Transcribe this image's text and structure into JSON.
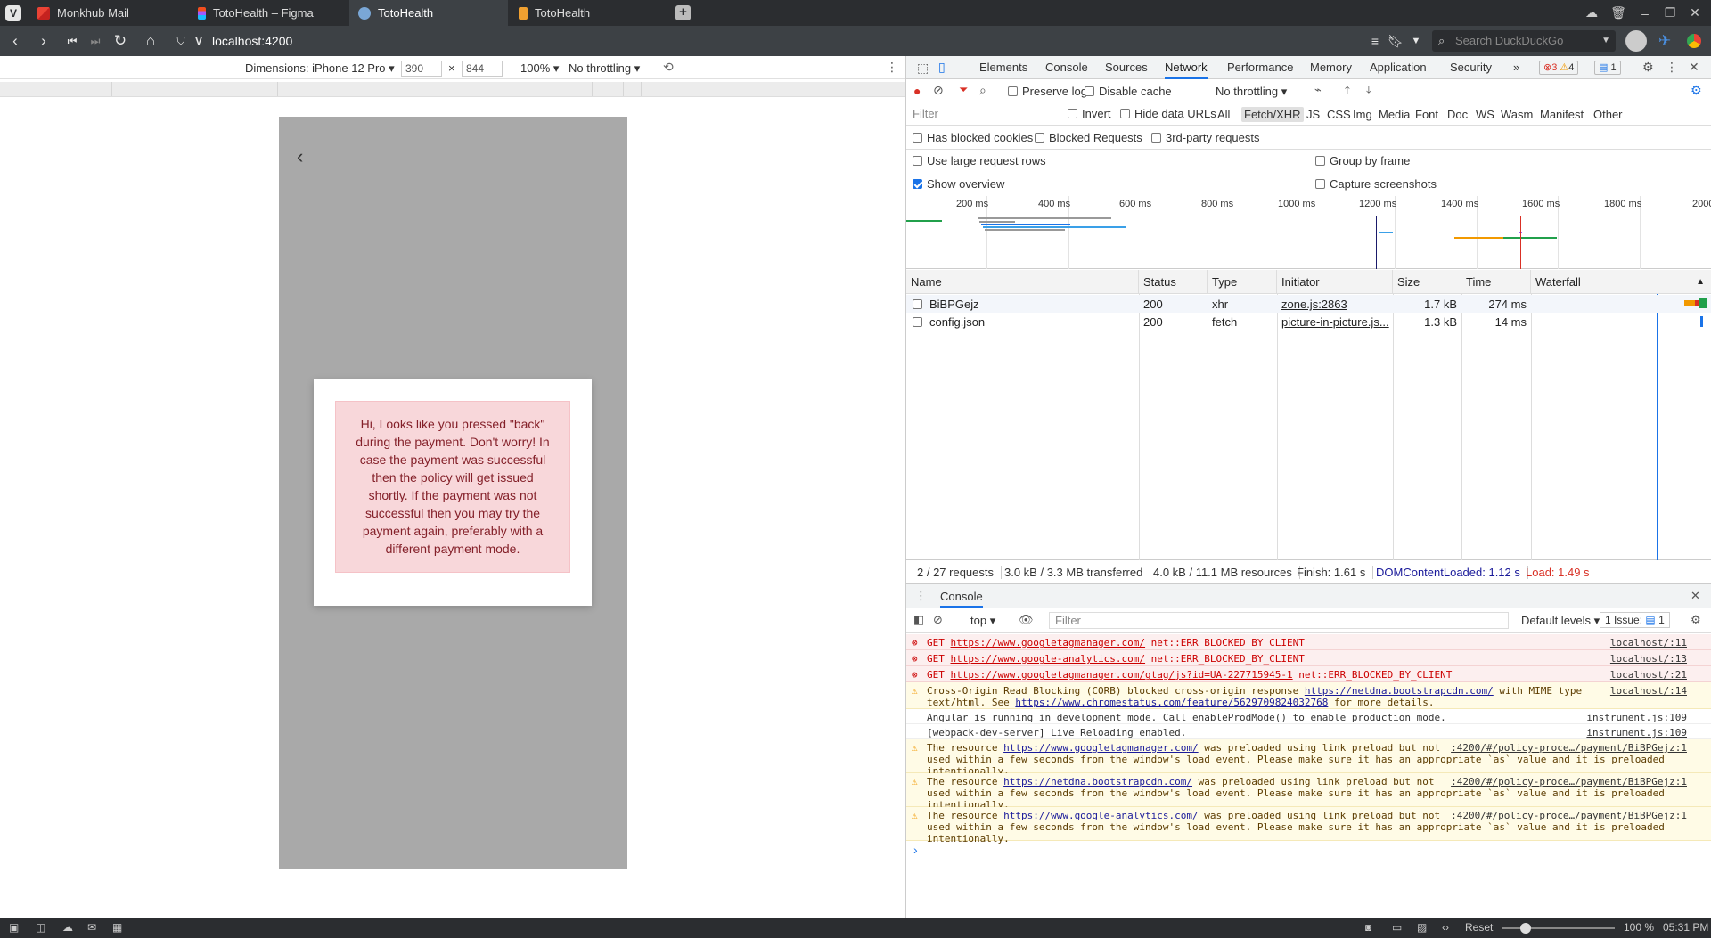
{
  "browser": {
    "tabs": [
      {
        "label": "Monkhub Mail",
        "favicon": "gmail-icon"
      },
      {
        "label": "TotoHealth – Figma",
        "favicon": "figma-icon"
      },
      {
        "label": "TotoHealth",
        "favicon": "totohealth-icon",
        "active": true
      },
      {
        "label": "TotoHealth",
        "favicon": "angular-icon"
      }
    ],
    "url": "localhost:4200",
    "search_placeholder": "Search DuckDuckGo"
  },
  "device_toolbar": {
    "dimensions_label": "Dimensions: iPhone 12 Pro",
    "width": "390",
    "height": "844",
    "times": "×",
    "zoom": "100%",
    "throttling": "No throttling"
  },
  "page": {
    "alert_text": "Hi, Looks like you pressed \"back\" during the payment. Don't worry! In case the payment was successful then the policy will get issued shortly. If the payment was not successful then you may try the payment again, preferably with a different payment mode."
  },
  "devtools": {
    "tabs": [
      "Elements",
      "Console",
      "Sources",
      "Network",
      "Performance",
      "Memory",
      "Application",
      "Security"
    ],
    "active_tab": "Network",
    "more": "»",
    "errors": "3",
    "warnings": "4",
    "messages": "1",
    "network_toolbar": {
      "preserve_log": "Preserve log",
      "disable_cache": "Disable cache",
      "throttling": "No throttling"
    },
    "filter": {
      "placeholder": "Filter",
      "invert": "Invert",
      "hide_data_urls": "Hide data URLs",
      "types": [
        "All",
        "Fetch/XHR",
        "JS",
        "CSS",
        "Img",
        "Media",
        "Font",
        "Doc",
        "WS",
        "Wasm",
        "Manifest",
        "Other"
      ],
      "active_type": "Fetch/XHR"
    },
    "options": {
      "has_blocked_cookies": "Has blocked cookies",
      "blocked_requests": "Blocked Requests",
      "third_party": "3rd-party requests",
      "large_rows": "Use large request rows",
      "group_by_frame": "Group by frame",
      "show_overview": "Show overview",
      "capture_screenshots": "Capture screenshots"
    },
    "overview_ticks": [
      "200 ms",
      "400 ms",
      "600 ms",
      "800 ms",
      "1000 ms",
      "1200 ms",
      "1400 ms",
      "1600 ms",
      "1800 ms",
      "2000"
    ],
    "table": {
      "columns": [
        "Name",
        "Status",
        "Type",
        "Initiator",
        "Size",
        "Time",
        "Waterfall"
      ],
      "rows": [
        {
          "name": "BiBPGejz",
          "status": "200",
          "type": "xhr",
          "initiator": "zone.js:2863",
          "size": "1.7 kB",
          "time": "274 ms"
        },
        {
          "name": "config.json",
          "status": "200",
          "type": "fetch",
          "initiator": "picture-in-picture.js...",
          "size": "1.3 kB",
          "time": "14 ms"
        }
      ]
    },
    "summary": {
      "requests": "2 / 27 requests",
      "transferred": "3.0 kB / 3.3 MB transferred",
      "resources": "4.0 kB / 11.1 MB resources",
      "finish": "Finish: 1.61 s",
      "dom": "DOMContentLoaded: 1.12 s",
      "load": "Load: 1.49 s"
    },
    "console": {
      "title": "Console",
      "context": "top",
      "filter_placeholder": "Filter",
      "levels": "Default levels",
      "issues": "1 Issue:",
      "issues_count": "1",
      "messages": [
        {
          "kind": "err",
          "pre": "GET ",
          "link": "https://www.googletagmanager.com/",
          "post": " net::ERR_BLOCKED_BY_CLIENT",
          "src": "localhost/:11"
        },
        {
          "kind": "err",
          "pre": "GET ",
          "link": "https://www.google-analytics.com/",
          "post": " net::ERR_BLOCKED_BY_CLIENT",
          "src": "localhost/:13"
        },
        {
          "kind": "err",
          "pre": "GET ",
          "link": "https://www.googletagmanager.com/gtag/js?id=UA-227715945-1",
          "post": " net::ERR_BLOCKED_BY_CLIENT",
          "src": "localhost/:21"
        },
        {
          "kind": "warn",
          "pre": "Cross-Origin Read Blocking (CORB) blocked cross-origin response ",
          "link": "https://netdna.bootstrapcdn.com/",
          "post": " with MIME type",
          "line2pre": "text/html. See ",
          "line2link": "https://www.chromestatus.com/feature/5629709824032768",
          "line2post": " for more details.",
          "src": "localhost/:14"
        },
        {
          "kind": "info",
          "pre": "Angular is running in development mode. Call enableProdMode() to enable production mode.",
          "src": "instrument.js:109"
        },
        {
          "kind": "info",
          "pre": "[webpack-dev-server] Live Reloading enabled.",
          "src": "instrument.js:109"
        },
        {
          "kind": "warn",
          "pre": "The resource ",
          "link": "https://www.googletagmanager.com/",
          "post": " was preloaded using link preload but not",
          "line2pre": "used within a few seconds from the window's load event. Please make sure it has an appropriate `as` value and it is preloaded",
          "line3": "intentionally.",
          "src": ":4200/#/policy-proce…/payment/BiBPGejz:1"
        },
        {
          "kind": "warn",
          "pre": "The resource ",
          "link": "https://netdna.bootstrapcdn.com/",
          "post": " was preloaded using link preload but not",
          "line2pre": "used within a few seconds from the window's load event. Please make sure it has an appropriate `as` value and it is preloaded",
          "line3": "intentionally.",
          "src": ":4200/#/policy-proce…/payment/BiBPGejz:1"
        },
        {
          "kind": "warn",
          "pre": "The resource ",
          "link": "https://www.google-analytics.com/",
          "post": " was preloaded using link preload but not",
          "line2pre": "used within a few seconds from the window's load event. Please make sure it has an appropriate `as` value and it is preloaded",
          "line3": "intentionally.",
          "src": ":4200/#/policy-proce…/payment/BiBPGejz:1"
        }
      ],
      "prompt": "›"
    }
  },
  "statusbar": {
    "reset": "Reset",
    "zoom": "100 %",
    "time": "05:31 PM"
  },
  "colors": {
    "alert_bg": "#f8d7da",
    "alert_text": "#842029",
    "accent": "#1a73e8",
    "error": "#d93025",
    "warning": "#f29900"
  }
}
